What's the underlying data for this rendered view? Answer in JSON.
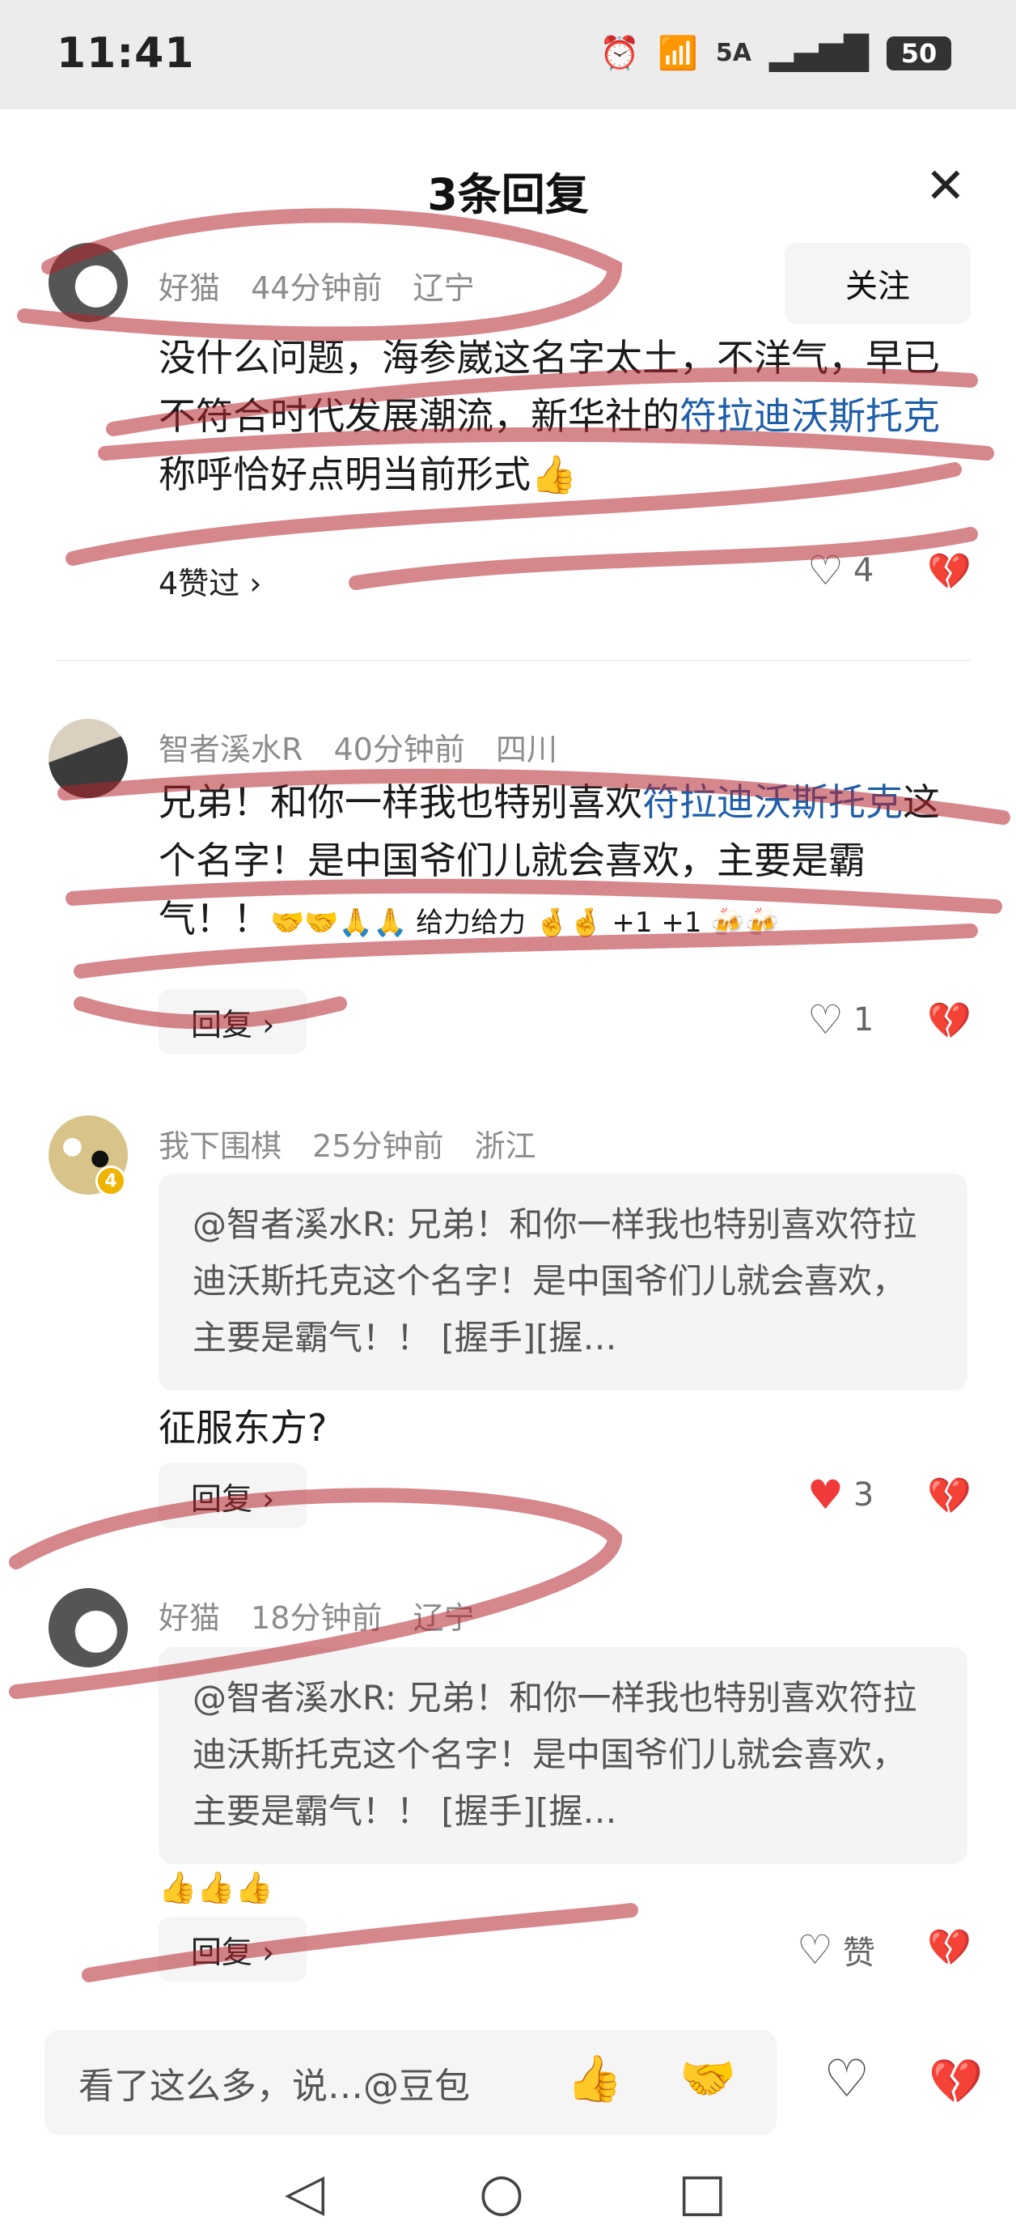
{
  "status": {
    "time": "11:41",
    "network": "5A",
    "battery": "50"
  },
  "header": {
    "title": "3条回复"
  },
  "comments": [
    {
      "user": "好猫",
      "time": "44分钟前",
      "location": "辽宁",
      "follow_label": "关注",
      "text_before": "没什么问题，海参崴这名字太土，不洋气，早已不符合时代发展潮流，新华社的",
      "text_link": "符拉迪沃斯托克",
      "text_after": "称呼恰好点明当前形式👍",
      "liked_label": "4赞过 ›",
      "likes": "4"
    },
    {
      "user": "智者溪水R",
      "time": "40分钟前",
      "location": "四川",
      "text_before": "兄弟！和你一样我也特别喜欢",
      "text_link": "符拉迪沃斯托克",
      "text_after": "这个名字！是中国爷们儿就会喜欢，主要是霸气！！",
      "emoji_tail": "🤝🤝🙏🙏 给力给力 🤞🤞 +1 +1 🍻🍻",
      "reply_label": "回复 ›",
      "likes": "1"
    },
    {
      "user": "我下围棋",
      "time": "25分钟前",
      "location": "浙江",
      "badge": "4",
      "quote": "@智者溪水R: 兄弟！和你一样我也特别喜欢符拉迪沃斯托克这个名字！是中国爷们儿就会喜欢，主要是霸气！！ [握手][握…",
      "text": "征服东方?",
      "reply_label": "回复 ›",
      "likes": "3"
    },
    {
      "user": "好猫",
      "time": "18分钟前",
      "location": "辽宁",
      "quote": "@智者溪水R: 兄弟！和你一样我也特别喜欢符拉迪沃斯托克这个名字！是中国爷们儿就会喜欢，主要是霸气！！ [握手][握…",
      "text": "👍👍👍",
      "reply_label": "回复 ›",
      "likes": "赞"
    }
  ],
  "composer": {
    "placeholder": "看了这么多，说…@豆包"
  },
  "icons": {
    "close": "close-icon",
    "heart": "heart-icon",
    "broken_heart": "broken-heart-icon",
    "alarm": "alarm-icon",
    "wifi": "wifi-icon",
    "signal": "signal-icon"
  },
  "colors": {
    "link": "#1f5ea8",
    "liked": "#f03a3a",
    "scribble": "#b4252d"
  }
}
